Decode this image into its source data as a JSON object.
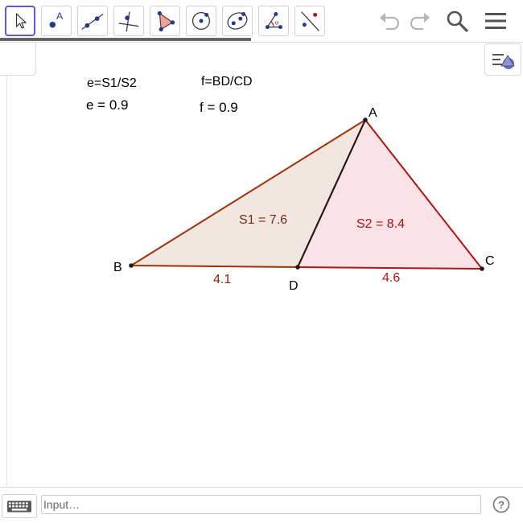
{
  "toolbar": {
    "tools": [
      {
        "name": "move-tool-button",
        "icon": "arrow-cursor-icon",
        "selected": true
      },
      {
        "name": "point-tool-button",
        "icon": "point-icon",
        "label": "A"
      },
      {
        "name": "line-tool-button",
        "icon": "line-through-points-icon"
      },
      {
        "name": "perpendicular-line-tool-button",
        "icon": "perpendicular-line-icon"
      },
      {
        "name": "polygon-tool-button",
        "icon": "polygon-icon"
      },
      {
        "name": "circle-tool-button",
        "icon": "circle-with-center-icon"
      },
      {
        "name": "conic-tool-button",
        "icon": "ellipse-icon"
      },
      {
        "name": "angle-tool-button",
        "icon": "angle-icon",
        "label": "α"
      },
      {
        "name": "reflect-tool-button",
        "icon": "reflect-about-line-icon"
      }
    ],
    "undo_icon": "undo-icon",
    "redo_icon": "redo-icon",
    "search_icon": "search-icon",
    "menu_icon": "hamburger-menu-icon"
  },
  "style_bar_icon": "graphics-style-icon",
  "algebra": {
    "e_def": "e=S1/S2",
    "e_val": "e = 0.9",
    "f_def": "f=BD/CD",
    "f_val": "f = 0.9"
  },
  "geometry": {
    "points": {
      "A": "A",
      "B": "B",
      "C": "C",
      "D": "D"
    },
    "labels": {
      "s1": "S1 = 7.6",
      "s2": "S2 = 8.4",
      "bd": "4.1",
      "dc": "4.6"
    },
    "colors": {
      "s1_fill": "#f2e6e0",
      "s1_edge": "#a0320a",
      "s2_fill": "#fbe2e6",
      "s2_edge": "#b01414",
      "segment_ad": "#1a1a1a",
      "label_s1": "#7a2a10",
      "label_s2": "#b01414"
    }
  },
  "input_bar": {
    "placeholder": "Input…",
    "keyboard_icon": "keyboard-icon",
    "help_icon": "help-icon",
    "help_glyph": "?"
  }
}
